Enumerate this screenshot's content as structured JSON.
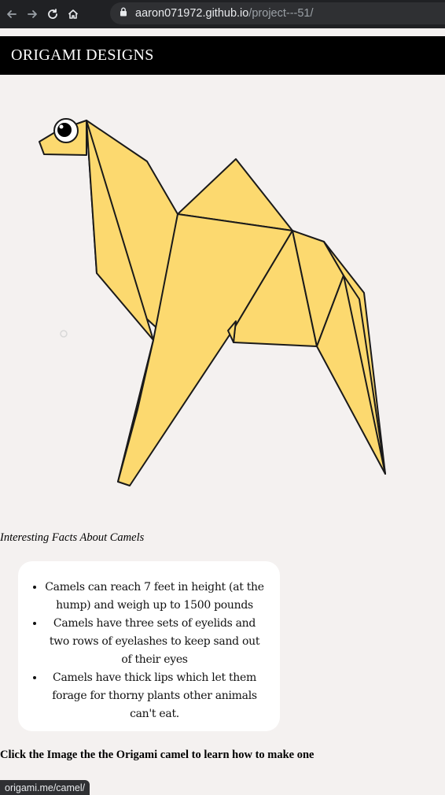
{
  "browser": {
    "url_domain": "aaron071972.github.io",
    "url_path": "/project---51/"
  },
  "header": {
    "title": "ORIGAMI DESIGNS"
  },
  "camel_image": {
    "fill_color": "#fcd96f",
    "stroke_color": "#1a1a1a"
  },
  "facts": {
    "title": "Interesting Facts About Camels",
    "items": [
      "Camels can reach 7 feet in height (at the hump) and weigh up to 1500 pounds",
      "Camels have three sets of eyelids and two rows of eyelashes to keep sand out of their eyes",
      "Camels have thick lips which let them forage for thorny plants other animals can't eat."
    ]
  },
  "cta": {
    "text": "Click the Image the the Origami camel to learn how to make one"
  },
  "status_bar": {
    "link_url": "origami.me/camel/"
  }
}
